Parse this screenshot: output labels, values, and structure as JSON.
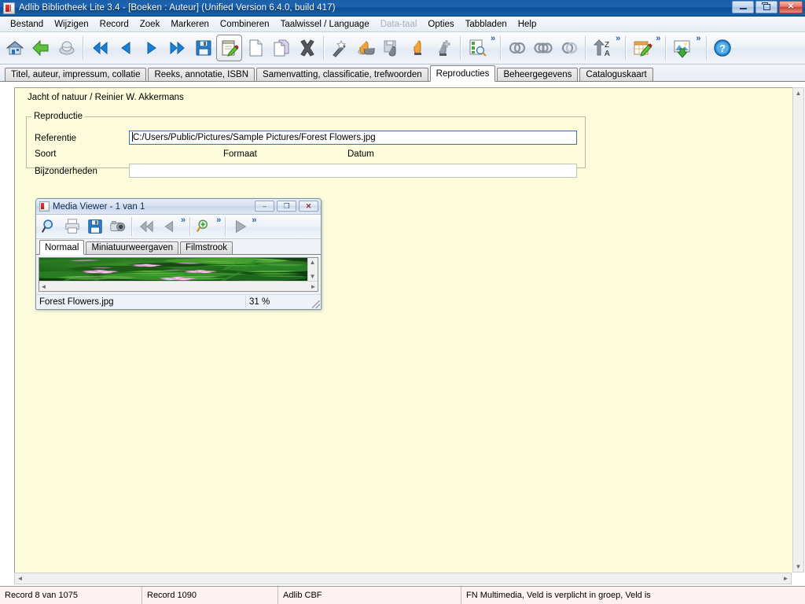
{
  "window": {
    "title": "Adlib Bibliotheek Lite 3.4 - [Boeken : Auteur] (Unified Version 6.4.0, build 417)",
    "app_icon": "adlib-icon",
    "minimize_label": "–",
    "restore_label": "❐",
    "close_label": "✕"
  },
  "menu": {
    "items": [
      {
        "label": "Bestand",
        "disabled": false
      },
      {
        "label": "Wijzigen",
        "disabled": false
      },
      {
        "label": "Record",
        "disabled": false
      },
      {
        "label": "Zoek",
        "disabled": false
      },
      {
        "label": "Markeren",
        "disabled": false
      },
      {
        "label": "Combineren",
        "disabled": false
      },
      {
        "label": "Taalwissel / Language",
        "disabled": false
      },
      {
        "label": "Data-taal",
        "disabled": true
      },
      {
        "label": "Opties",
        "disabled": false
      },
      {
        "label": "Tabbladen",
        "disabled": false
      },
      {
        "label": "Help",
        "disabled": false
      }
    ]
  },
  "toolbar": {
    "overflow_chevron": "»",
    "groups": [
      {
        "buttons": [
          {
            "icon": "home-icon",
            "name": "home-button"
          },
          {
            "icon": "back-arrow-icon",
            "name": "back-button"
          },
          {
            "icon": "globe-search-icon",
            "name": "search-all-button"
          }
        ]
      },
      {
        "buttons": [
          {
            "icon": "first-record-icon",
            "name": "first-record-button"
          },
          {
            "icon": "previous-record-icon",
            "name": "previous-record-button"
          },
          {
            "icon": "next-record-icon",
            "name": "next-record-button"
          },
          {
            "icon": "last-record-icon",
            "name": "last-record-button"
          },
          {
            "icon": "save-icon",
            "name": "save-button"
          },
          {
            "icon": "edit-record-icon",
            "name": "edit-record-button",
            "active": true
          },
          {
            "icon": "new-record-icon",
            "name": "new-record-button"
          },
          {
            "icon": "copy-record-icon",
            "name": "copy-record-button"
          },
          {
            "icon": "delete-record-icon",
            "name": "delete-record-button"
          }
        ]
      },
      {
        "buttons": [
          {
            "icon": "magic-wand-icon",
            "name": "wizard-button"
          },
          {
            "icon": "pointer-link-icon",
            "name": "link-button"
          },
          {
            "icon": "save-pointer-icon",
            "name": "save-pointer-button"
          },
          {
            "icon": "pointer-icon",
            "name": "pointer-button"
          },
          {
            "icon": "pointer-add-icon",
            "name": "pointer-add-button"
          }
        ]
      },
      {
        "buttons": [
          {
            "icon": "check-search-icon",
            "name": "validate-button"
          }
        ]
      },
      {
        "buttons": [
          {
            "icon": "rings-two-icon",
            "name": "merge-two-button"
          },
          {
            "icon": "rings-three-icon",
            "name": "merge-three-button"
          },
          {
            "icon": "rings-pair-icon",
            "name": "merge-pair-button"
          }
        ]
      },
      {
        "buttons": [
          {
            "icon": "sort-za-icon",
            "name": "sort-button"
          }
        ]
      },
      {
        "buttons": [
          {
            "icon": "spreadsheet-edit-icon",
            "name": "edit-table-button"
          }
        ]
      },
      {
        "buttons": [
          {
            "icon": "export-image-icon",
            "name": "export-button"
          }
        ]
      },
      {
        "buttons": [
          {
            "icon": "help-icon",
            "name": "help-button"
          }
        ]
      }
    ]
  },
  "record_tabs": [
    {
      "label": "Titel, auteur, impressum, collatie",
      "active": false
    },
    {
      "label": "Reeks, annotatie, ISBN",
      "active": false
    },
    {
      "label": "Samenvatting, classificatie, trefwoorden",
      "active": false
    },
    {
      "label": "Reproducties",
      "active": true
    },
    {
      "label": "Beheergegevens",
      "active": false
    },
    {
      "label": "Cataloguskaart",
      "active": false
    }
  ],
  "form": {
    "record_title": "Jacht of natuur / Reinier W. Akkermans",
    "group_legend": "Reproductie",
    "referentie_label": "Referentie",
    "referentie_value": "C:/Users/Public/Pictures/Sample Pictures/Forest Flowers.jpg",
    "soort_label": "Soort",
    "soort_value": "",
    "formaat_label": "Formaat",
    "formaat_value": "",
    "datum_label": "Datum",
    "datum_value": "",
    "bijzonderheden_label": "Bijzonderheden",
    "bijzonderheden_value": ""
  },
  "media_viewer": {
    "title": "Media Viewer - 1 van 1",
    "minimize_label": "–",
    "restore_label": "❐",
    "close_label": "✕",
    "overflow_chevron": "»",
    "toolbar": [
      {
        "icon": "magnifier-icon",
        "name": "zoom-tool-button"
      },
      {
        "icon": "print-icon",
        "name": "print-button"
      },
      {
        "icon": "save-icon",
        "name": "save-media-button"
      },
      {
        "icon": "camera-icon",
        "name": "capture-button"
      },
      {
        "icon": "first-media-icon",
        "name": "first-media-button"
      },
      {
        "icon": "previous-media-icon",
        "name": "previous-media-button"
      },
      {
        "icon": "zoom-in-icon",
        "name": "zoom-in-button"
      },
      {
        "icon": "play-icon",
        "name": "play-button"
      }
    ],
    "tabs": [
      {
        "label": "Normaal",
        "active": true
      },
      {
        "label": "Miniatuurweergaven",
        "active": false
      },
      {
        "label": "Filmstrook",
        "active": false
      }
    ],
    "status": {
      "filename": "Forest Flowers.jpg",
      "zoom": "31 %"
    },
    "image_alt": "forest-flowers-photo"
  },
  "statusbar": {
    "cells": [
      "Record 8 van 1075",
      "Record 1090",
      "Adlib CBF",
      "FN Multimedia, Veld is verplicht in groep, Veld is"
    ]
  },
  "scroll": {
    "up_arrow": "▲",
    "down_arrow": "▼",
    "left_arrow": "◄",
    "right_arrow": "►"
  },
  "colors": {
    "title_bar": "#1563ad",
    "form_background": "#fcfcdd",
    "status_background": "#fdf2f2",
    "accent": "#2a5ea8"
  }
}
